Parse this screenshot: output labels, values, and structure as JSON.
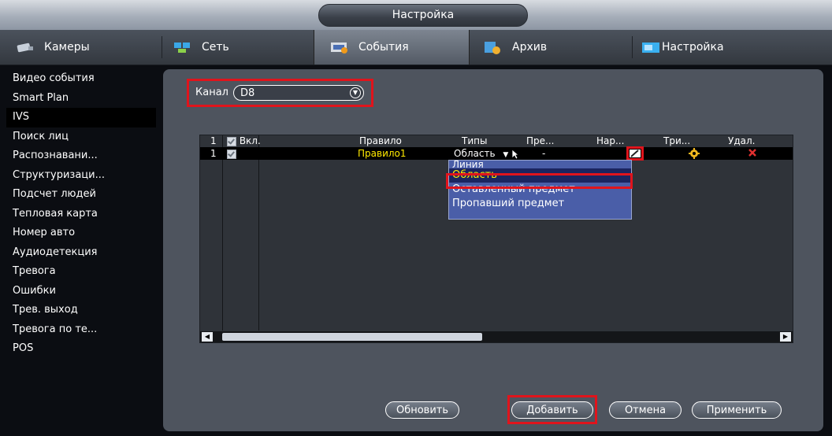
{
  "window": {
    "title": "Настройка"
  },
  "tabs": [
    {
      "label": "Камеры",
      "icon": "camera-icon",
      "active": false
    },
    {
      "label": "Сеть",
      "icon": "network-icon",
      "active": false
    },
    {
      "label": "События",
      "icon": "events-icon",
      "active": true
    },
    {
      "label": "Архив",
      "icon": "archive-icon",
      "active": false
    },
    {
      "label": "Настройка",
      "icon": "settings-icon",
      "active": false
    }
  ],
  "sidebar": {
    "items": [
      {
        "label": "Видео события"
      },
      {
        "label": "Smart Plan"
      },
      {
        "label": "IVS",
        "active": true
      },
      {
        "label": "Поиск лиц"
      },
      {
        "label": "Распознавани..."
      },
      {
        "label": "Структуризаци..."
      },
      {
        "label": "Подсчет людей"
      },
      {
        "label": "Тепловая карта"
      },
      {
        "label": "Номер авто"
      },
      {
        "label": "Аудиодетекция"
      },
      {
        "label": "Тревога"
      },
      {
        "label": "Ошибки"
      },
      {
        "label": "Трев. выход"
      },
      {
        "label": "Тревога по те..."
      },
      {
        "label": "POS"
      }
    ]
  },
  "channel": {
    "label": "Канал",
    "value": "D8"
  },
  "table": {
    "headers": {
      "num": "1",
      "enable": "Вкл.",
      "rule": "Правило",
      "type": "Типы",
      "preset": "Пре...",
      "draw": "Нар...",
      "trigger": "Три...",
      "delete": "Удал."
    },
    "rows": [
      {
        "num": "1",
        "rule": "Правило1",
        "type": "Область",
        "preset": "-"
      }
    ]
  },
  "type_dropdown": {
    "options": [
      "Линия",
      "Область",
      "Оставленный предмет",
      "Пропавший предмет"
    ],
    "selected": "Область"
  },
  "buttons": {
    "refresh": "Обновить",
    "add": "Добавить",
    "cancel": "Отмена",
    "apply": "Применить"
  },
  "colors": {
    "highlight_box": "#e0141c",
    "dropdown_bg": "#4a5ea8",
    "selected_text": "#ffea00",
    "panel_bg": "#4e545e"
  }
}
